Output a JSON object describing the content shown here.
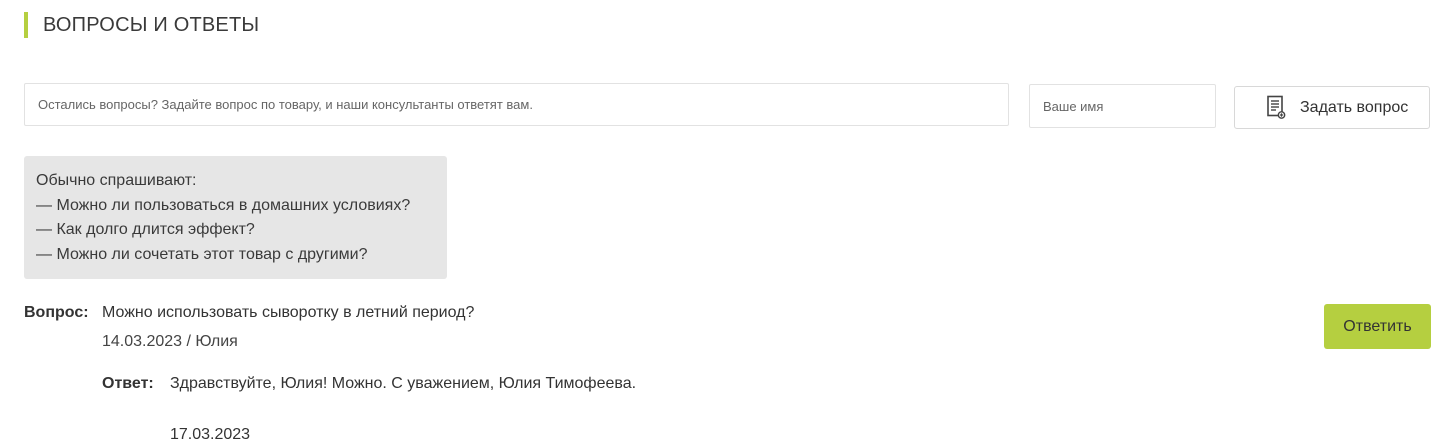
{
  "section": {
    "title": "ВОПРОСЫ И ОТВЕТЫ",
    "accent_color": "#b5cf40"
  },
  "form": {
    "question_placeholder": "Остались вопросы? Задайте вопрос по товару, и наши консультанты ответят вам.",
    "name_placeholder": "Ваше имя",
    "ask_button_label": "Задать вопрос",
    "ask_button_icon": "document-icon"
  },
  "hints": {
    "heading": "Обычно спрашивают:",
    "items": [
      "— Можно ли пользоваться в домашних условиях?",
      "— Как долго длится эффект?",
      "— Можно ли сочетать этот товар с другими?"
    ]
  },
  "qa": {
    "question_label": "Вопрос:",
    "question_text": "Можно использовать сыворотку в летний период?",
    "question_meta": "14.03.2023 / Юлия",
    "reply_button_label": "Ответить",
    "answer_label": "Ответ:",
    "answer_text": "Здравствуйте, Юлия! Можно. С уважением, Юлия Тимофеева.",
    "answer_date": "17.03.2023"
  }
}
